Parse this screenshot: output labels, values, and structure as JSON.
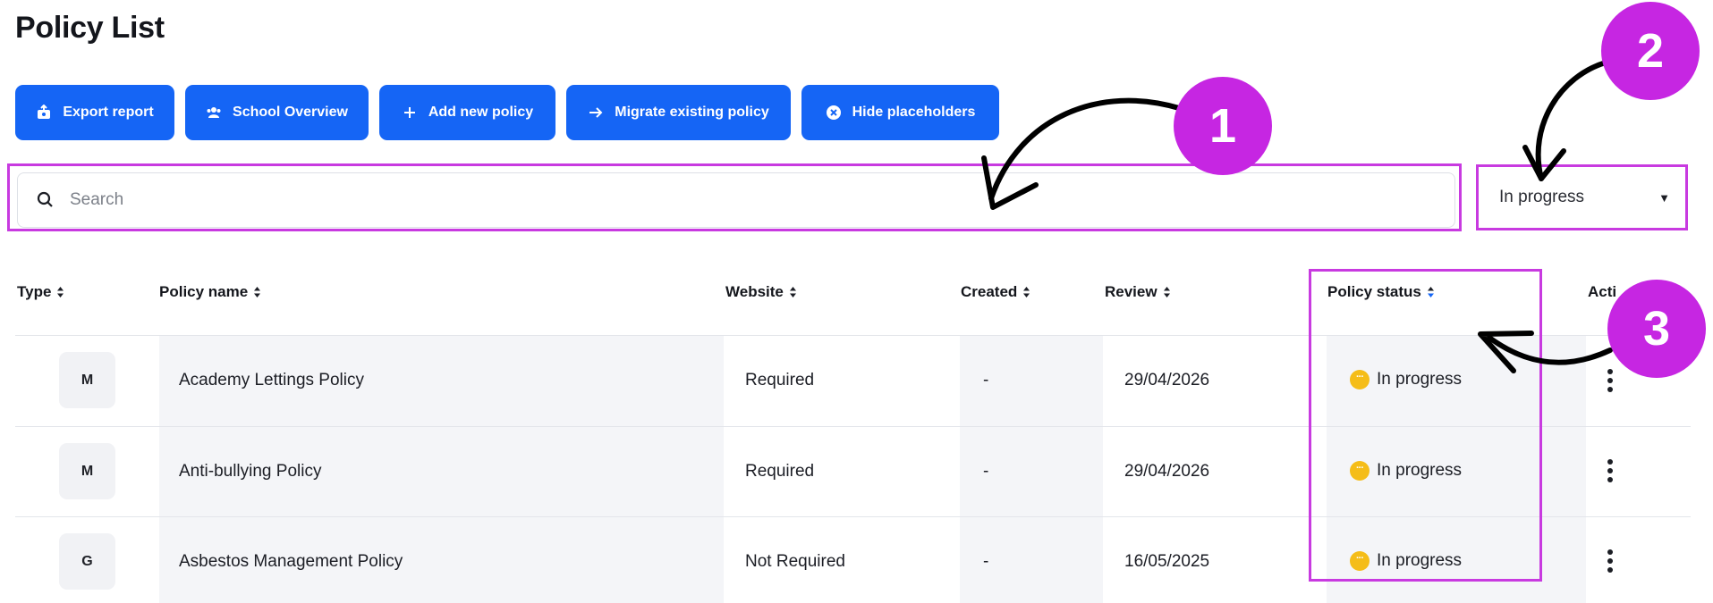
{
  "page": {
    "title": "Policy List"
  },
  "toolbar": {
    "buttons": [
      {
        "label": "Export report",
        "icon": "export-icon"
      },
      {
        "label": "School Overview",
        "icon": "users-icon"
      },
      {
        "label": "Add new policy",
        "icon": "plus-icon"
      },
      {
        "label": "Migrate existing policy",
        "icon": "arrow-right-icon"
      },
      {
        "label": "Hide placeholders",
        "icon": "close-circle-icon"
      }
    ]
  },
  "search": {
    "placeholder": "Search",
    "value": ""
  },
  "status_filter": {
    "selected": "In progress"
  },
  "table": {
    "columns": [
      "Type",
      "Policy name",
      "Website",
      "Created",
      "Review",
      "Policy status",
      "Actions"
    ],
    "visible_column_label_actions": "Acti",
    "rows": [
      {
        "type": "M",
        "name": "Academy Lettings Policy",
        "website": "Required",
        "created": "-",
        "review": "29/04/2026",
        "status": "In progress"
      },
      {
        "type": "M",
        "name": "Anti-bullying Policy",
        "website": "Required",
        "created": "-",
        "review": "29/04/2026",
        "status": "In progress"
      },
      {
        "type": "G",
        "name": "Asbestos Management Policy",
        "website": "Not Required",
        "created": "-",
        "review": "16/05/2025",
        "status": "In progress"
      }
    ]
  },
  "callouts": [
    "1",
    "2",
    "3"
  ],
  "colors": {
    "accent": "#1565f5",
    "highlight": "#c83ae0",
    "callout": "#c626e2",
    "status_in_progress": "#f5bd18"
  }
}
